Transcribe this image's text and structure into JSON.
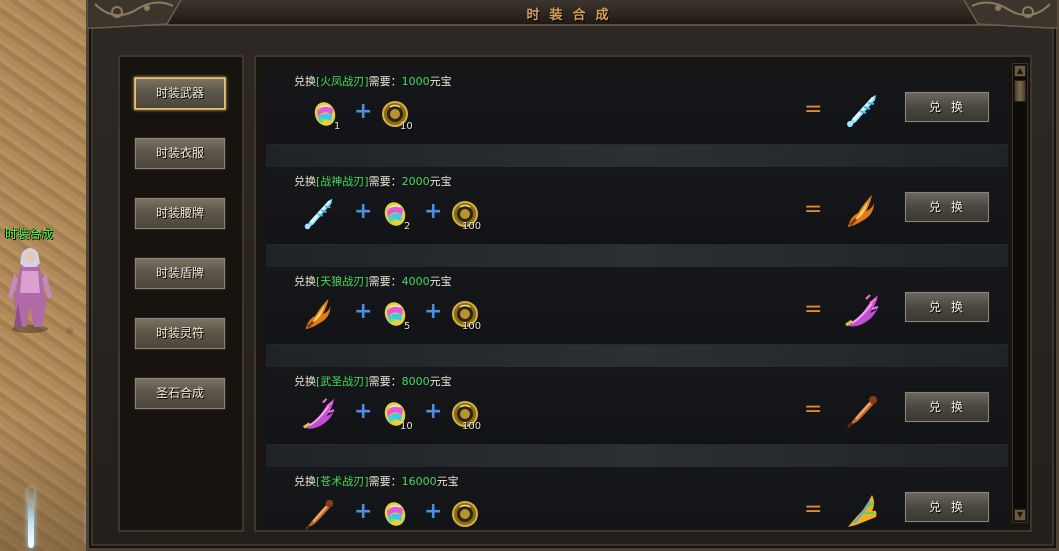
{
  "world": {
    "npc_name": "时装合成"
  },
  "window": {
    "title": "时装合成"
  },
  "sidebar": {
    "items": [
      {
        "label": "时装武器",
        "active": true
      },
      {
        "label": "时装衣服",
        "active": false
      },
      {
        "label": "时装腰牌",
        "active": false
      },
      {
        "label": "时装盾牌",
        "active": false
      },
      {
        "label": "时装灵符",
        "active": false
      },
      {
        "label": "圣石合成",
        "active": false
      }
    ]
  },
  "recipes": [
    {
      "prefix": "兑换",
      "name": "[火凤战刃]",
      "mid": "需要：",
      "cost": "1000",
      "unit": "元宝",
      "ingredients": [
        {
          "icon": "rainbow-gem-icon",
          "count": "1"
        },
        {
          "icon": "gold-coin-icon",
          "count": "10"
        }
      ],
      "result_icon": "ice-blade-icon",
      "button": "兑换"
    },
    {
      "prefix": "兑换",
      "name": "[战神战刃]",
      "mid": "需要：",
      "cost": "2000",
      "unit": "元宝",
      "ingredients": [
        {
          "icon": "ice-blade-icon",
          "count": ""
        },
        {
          "icon": "rainbow-gem-icon",
          "count": "2"
        },
        {
          "icon": "gold-coin-icon",
          "count": "100"
        }
      ],
      "result_icon": "flame-blade-icon",
      "button": "兑换"
    },
    {
      "prefix": "兑换",
      "name": "[天狼战刃]",
      "mid": "需要：",
      "cost": "4000",
      "unit": "元宝",
      "ingredients": [
        {
          "icon": "flame-blade-icon",
          "count": ""
        },
        {
          "icon": "rainbow-gem-icon",
          "count": "5"
        },
        {
          "icon": "gold-coin-icon",
          "count": "100"
        }
      ],
      "result_icon": "purple-blade-icon",
      "button": "兑换"
    },
    {
      "prefix": "兑换",
      "name": "[武圣战刃]",
      "mid": "需要：",
      "cost": "8000",
      "unit": "元宝",
      "ingredients": [
        {
          "icon": "purple-blade-icon",
          "count": ""
        },
        {
          "icon": "rainbow-gem-icon",
          "count": "10"
        },
        {
          "icon": "gold-coin-icon",
          "count": "100"
        }
      ],
      "result_icon": "bronze-blade-icon",
      "button": "兑换"
    },
    {
      "prefix": "兑换",
      "name": "[苍术战刃]",
      "mid": "需要：",
      "cost": "16000",
      "unit": "元宝",
      "ingredients": [
        {
          "icon": "bronze-blade-icon",
          "count": ""
        },
        {
          "icon": "rainbow-gem-icon",
          "count": ""
        },
        {
          "icon": "gold-coin-icon",
          "count": ""
        }
      ],
      "result_icon": "feather-blade-icon",
      "button": "兑换"
    }
  ],
  "colors": {
    "item_name": "#48d95a",
    "title": "#d7a05a",
    "plus": "#4a8fe0",
    "equals": "#e08a2a"
  }
}
